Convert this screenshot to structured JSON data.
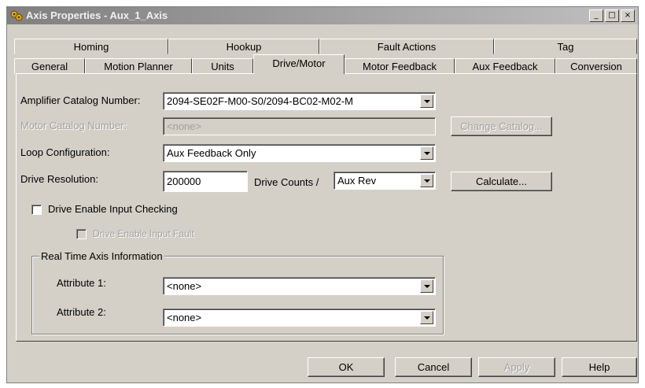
{
  "window": {
    "title": "Axis Properties - Aux_1_Axis",
    "controls": {
      "minimize": "_",
      "maximize": "□",
      "close": "×"
    }
  },
  "tabs_row1": [
    "Homing",
    "Hookup",
    "Fault Actions",
    "Tag"
  ],
  "tabs_row2": [
    "General",
    "Motion Planner",
    "Units",
    "Drive/Motor",
    "Motor Feedback",
    "Aux Feedback",
    "Conversion"
  ],
  "active_tab": "Drive/Motor",
  "form": {
    "amplifier_label": "Amplifier Catalog Number:",
    "amplifier_value": "2094-SE02F-M00-S0/2094-BC02-M02-M",
    "motor_label": "Motor Catalog Number:",
    "motor_value": "<none>",
    "change_catalog_button": "Change Catalog...",
    "loop_label": "Loop Configuration:",
    "loop_value": "Aux Feedback Only",
    "resolution_label": "Drive Resolution:",
    "resolution_value": "200000",
    "drive_counts_label": "Drive Counts /",
    "counts_unit_value": "Aux Rev",
    "calculate_button": "Calculate...",
    "enable_checking_label": "Drive Enable Input Checking",
    "enable_fault_label": "Drive Enable Input Fault",
    "group_title": "Real Time Axis Information",
    "attr1_label": "Attribute 1:",
    "attr1_value": "<none>",
    "attr2_label": "Attribute 2:",
    "attr2_value": "<none>"
  },
  "footer": {
    "ok": "OK",
    "cancel": "Cancel",
    "apply": "Apply",
    "help": "Help"
  }
}
